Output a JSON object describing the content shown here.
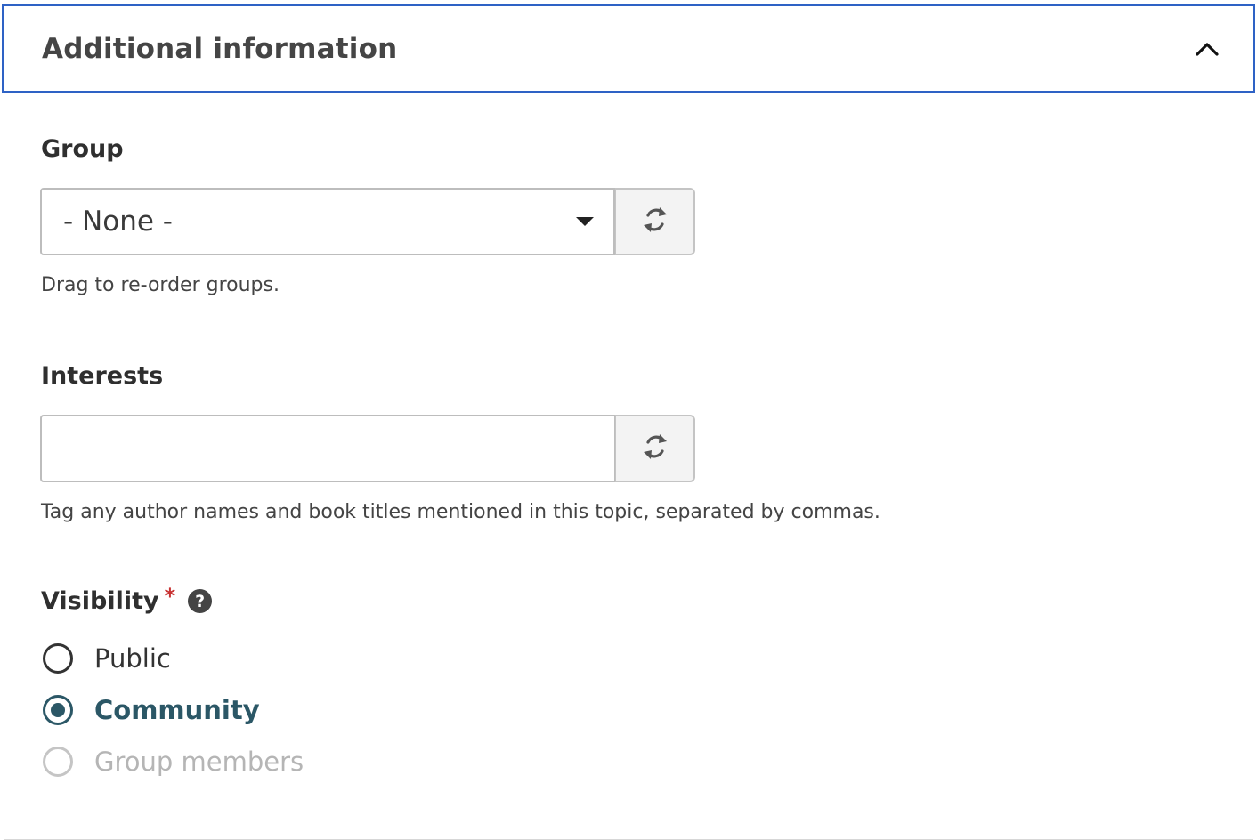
{
  "panel": {
    "title": "Additional information"
  },
  "group": {
    "label": "Group",
    "selected": "- None -",
    "help": "Drag to re-order groups."
  },
  "interests": {
    "label": "Interests",
    "value": "",
    "placeholder": "",
    "help": "Tag any author names and book titles mentioned in this topic, separated by commas."
  },
  "visibility": {
    "label": "Visibility",
    "required_marker": "*",
    "help_icon": "question-circle-icon",
    "options": [
      {
        "label": "Public",
        "state": "unchecked"
      },
      {
        "label": "Community",
        "state": "checked"
      },
      {
        "label": "Group members",
        "state": "disabled"
      }
    ]
  },
  "colors": {
    "header_border": "#2e62c5",
    "accent": "#2b5766",
    "required": "#c83232"
  }
}
